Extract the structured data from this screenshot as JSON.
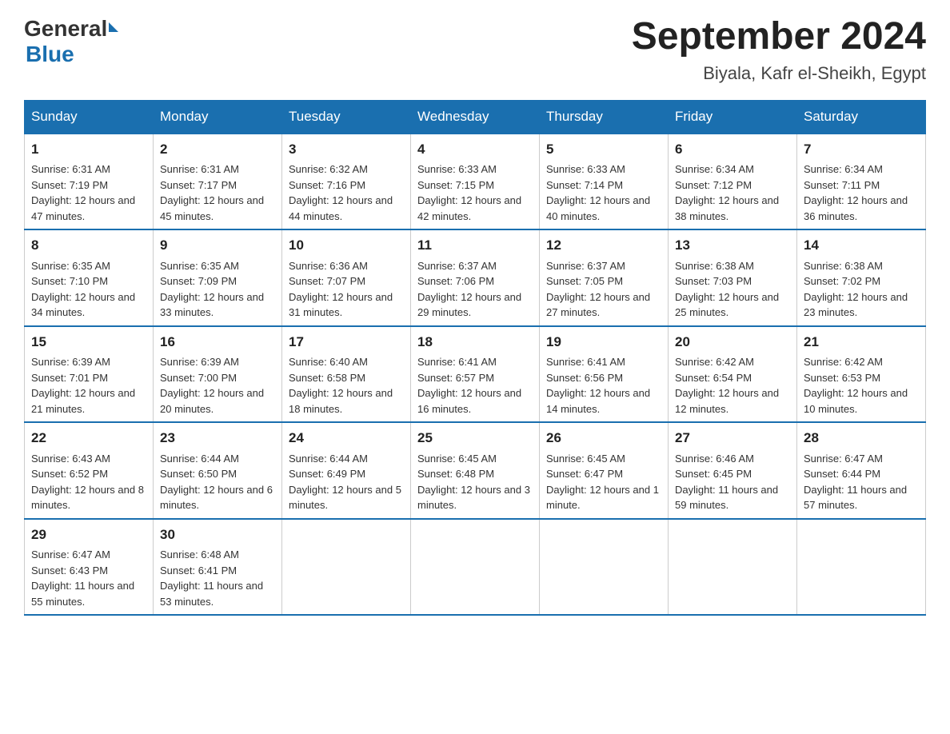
{
  "logo": {
    "general": "General",
    "blue": "Blue"
  },
  "title": "September 2024",
  "subtitle": "Biyala, Kafr el-Sheikh, Egypt",
  "headers": [
    "Sunday",
    "Monday",
    "Tuesday",
    "Wednesday",
    "Thursday",
    "Friday",
    "Saturday"
  ],
  "weeks": [
    [
      {
        "day": "1",
        "sunrise": "6:31 AM",
        "sunset": "7:19 PM",
        "daylight": "12 hours and 47 minutes."
      },
      {
        "day": "2",
        "sunrise": "6:31 AM",
        "sunset": "7:17 PM",
        "daylight": "12 hours and 45 minutes."
      },
      {
        "day": "3",
        "sunrise": "6:32 AM",
        "sunset": "7:16 PM",
        "daylight": "12 hours and 44 minutes."
      },
      {
        "day": "4",
        "sunrise": "6:33 AM",
        "sunset": "7:15 PM",
        "daylight": "12 hours and 42 minutes."
      },
      {
        "day": "5",
        "sunrise": "6:33 AM",
        "sunset": "7:14 PM",
        "daylight": "12 hours and 40 minutes."
      },
      {
        "day": "6",
        "sunrise": "6:34 AM",
        "sunset": "7:12 PM",
        "daylight": "12 hours and 38 minutes."
      },
      {
        "day": "7",
        "sunrise": "6:34 AM",
        "sunset": "7:11 PM",
        "daylight": "12 hours and 36 minutes."
      }
    ],
    [
      {
        "day": "8",
        "sunrise": "6:35 AM",
        "sunset": "7:10 PM",
        "daylight": "12 hours and 34 minutes."
      },
      {
        "day": "9",
        "sunrise": "6:35 AM",
        "sunset": "7:09 PM",
        "daylight": "12 hours and 33 minutes."
      },
      {
        "day": "10",
        "sunrise": "6:36 AM",
        "sunset": "7:07 PM",
        "daylight": "12 hours and 31 minutes."
      },
      {
        "day": "11",
        "sunrise": "6:37 AM",
        "sunset": "7:06 PM",
        "daylight": "12 hours and 29 minutes."
      },
      {
        "day": "12",
        "sunrise": "6:37 AM",
        "sunset": "7:05 PM",
        "daylight": "12 hours and 27 minutes."
      },
      {
        "day": "13",
        "sunrise": "6:38 AM",
        "sunset": "7:03 PM",
        "daylight": "12 hours and 25 minutes."
      },
      {
        "day": "14",
        "sunrise": "6:38 AM",
        "sunset": "7:02 PM",
        "daylight": "12 hours and 23 minutes."
      }
    ],
    [
      {
        "day": "15",
        "sunrise": "6:39 AM",
        "sunset": "7:01 PM",
        "daylight": "12 hours and 21 minutes."
      },
      {
        "day": "16",
        "sunrise": "6:39 AM",
        "sunset": "7:00 PM",
        "daylight": "12 hours and 20 minutes."
      },
      {
        "day": "17",
        "sunrise": "6:40 AM",
        "sunset": "6:58 PM",
        "daylight": "12 hours and 18 minutes."
      },
      {
        "day": "18",
        "sunrise": "6:41 AM",
        "sunset": "6:57 PM",
        "daylight": "12 hours and 16 minutes."
      },
      {
        "day": "19",
        "sunrise": "6:41 AM",
        "sunset": "6:56 PM",
        "daylight": "12 hours and 14 minutes."
      },
      {
        "day": "20",
        "sunrise": "6:42 AM",
        "sunset": "6:54 PM",
        "daylight": "12 hours and 12 minutes."
      },
      {
        "day": "21",
        "sunrise": "6:42 AM",
        "sunset": "6:53 PM",
        "daylight": "12 hours and 10 minutes."
      }
    ],
    [
      {
        "day": "22",
        "sunrise": "6:43 AM",
        "sunset": "6:52 PM",
        "daylight": "12 hours and 8 minutes."
      },
      {
        "day": "23",
        "sunrise": "6:44 AM",
        "sunset": "6:50 PM",
        "daylight": "12 hours and 6 minutes."
      },
      {
        "day": "24",
        "sunrise": "6:44 AM",
        "sunset": "6:49 PM",
        "daylight": "12 hours and 5 minutes."
      },
      {
        "day": "25",
        "sunrise": "6:45 AM",
        "sunset": "6:48 PM",
        "daylight": "12 hours and 3 minutes."
      },
      {
        "day": "26",
        "sunrise": "6:45 AM",
        "sunset": "6:47 PM",
        "daylight": "12 hours and 1 minute."
      },
      {
        "day": "27",
        "sunrise": "6:46 AM",
        "sunset": "6:45 PM",
        "daylight": "11 hours and 59 minutes."
      },
      {
        "day": "28",
        "sunrise": "6:47 AM",
        "sunset": "6:44 PM",
        "daylight": "11 hours and 57 minutes."
      }
    ],
    [
      {
        "day": "29",
        "sunrise": "6:47 AM",
        "sunset": "6:43 PM",
        "daylight": "11 hours and 55 minutes."
      },
      {
        "day": "30",
        "sunrise": "6:48 AM",
        "sunset": "6:41 PM",
        "daylight": "11 hours and 53 minutes."
      },
      null,
      null,
      null,
      null,
      null
    ]
  ]
}
